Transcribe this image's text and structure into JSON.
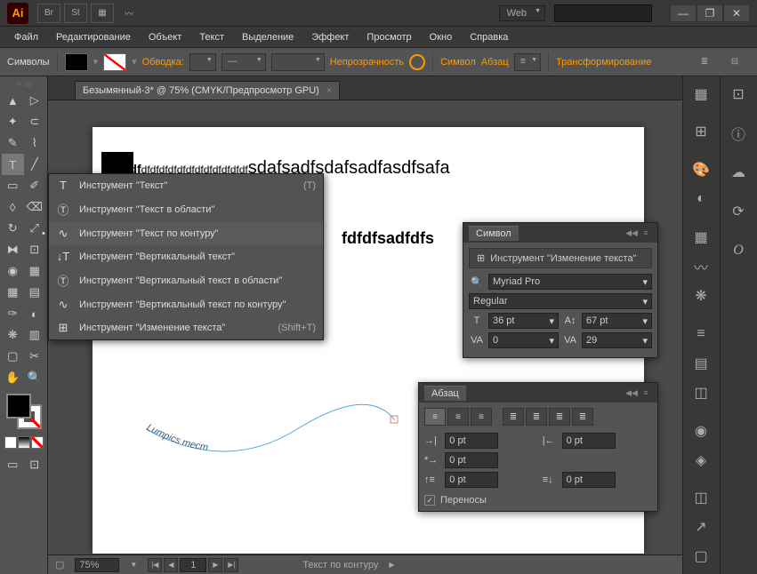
{
  "titlebar": {
    "logo": "Ai",
    "preset": "Web",
    "search_placeholder": ""
  },
  "menu": [
    "Файл",
    "Редактирование",
    "Объект",
    "Текст",
    "Выделение",
    "Эффект",
    "Просмотр",
    "Окно",
    "Справка"
  ],
  "options": {
    "symbols_label": "Символы",
    "stroke_label": "Обводка:",
    "opacity_label": "Непрозрачность",
    "char_link": "Символ",
    "para_link": "Абзац",
    "transform_link": "Трансформирование"
  },
  "doc_tab": "Безымянный-3* @ 75% (CMYK/Предпросмотр GPU)",
  "artboard": {
    "text1_bold": "dfdfdf",
    "text1_mid": "dfdfdfdfdfdfdfdfdfdfdfdf",
    "text1_rest": "sdafsadfsdafsadfasdfsafa",
    "text2": "fdfdfsadfdfs",
    "curve_text": "Lumpics тест"
  },
  "flyout": [
    {
      "icon": "T",
      "label": "Инструмент \"Текст\"",
      "shortcut": "(T)"
    },
    {
      "icon": "T",
      "label": "Инструмент \"Текст в области\"",
      "shortcut": ""
    },
    {
      "icon": "✓",
      "label": "Инструмент \"Текст по контуру\"",
      "shortcut": ""
    },
    {
      "icon": "IT",
      "label": "Инструмент \"Вертикальный текст\"",
      "shortcut": ""
    },
    {
      "icon": "IT",
      "label": "Инструмент \"Вертикальный текст в области\"",
      "shortcut": ""
    },
    {
      "icon": "✓",
      "label": "Инструмент \"Вертикальный текст по контуру\"",
      "shortcut": ""
    },
    {
      "icon": "⊞",
      "label": "Инструмент \"Изменение текста\"",
      "shortcut": "(Shift+T)"
    }
  ],
  "char_panel": {
    "title": "Символ",
    "tool_label": "Инструмент \"Изменение текста\"",
    "font": "Myriad Pro",
    "style": "Regular",
    "size": "36 pt",
    "leading": "67 pt",
    "kerning": "0",
    "tracking": "29"
  },
  "para_panel": {
    "title": "Абзац",
    "indent_left": "0 pt",
    "indent_right": "0 pt",
    "indent_first": "0 pt",
    "space_before": "0 pt",
    "space_after": "0 pt",
    "hyphenate": "Переносы"
  },
  "status": {
    "zoom": "75%",
    "page": "1",
    "tool": "Текст по контуру"
  }
}
